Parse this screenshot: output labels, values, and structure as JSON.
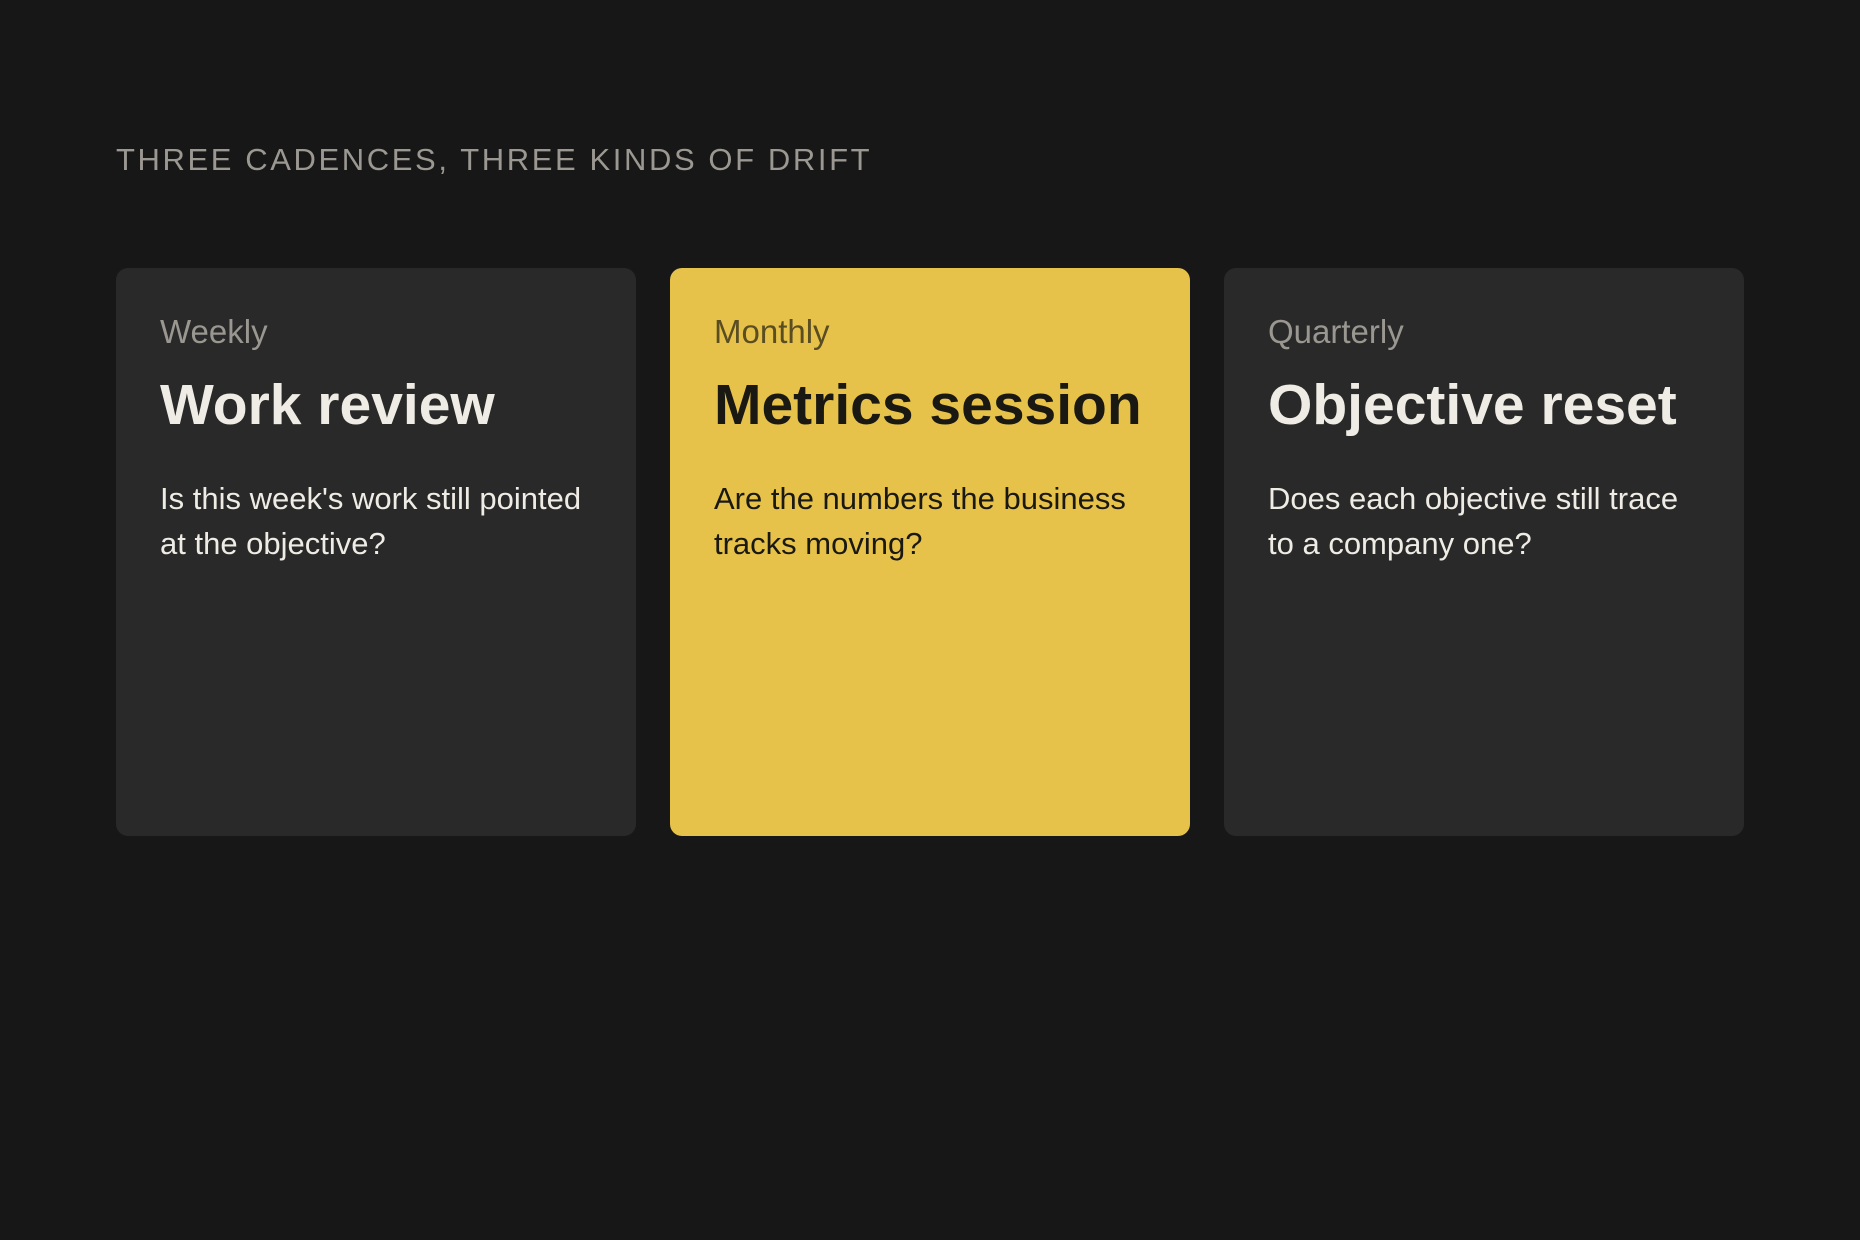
{
  "section": {
    "title": "THREE CADENCES, THREE KINDS OF DRIFT"
  },
  "cards": [
    {
      "cadence": "Weekly",
      "title": "Work review",
      "question": "Is this week's work still pointed at the objective?"
    },
    {
      "cadence": "Monthly",
      "title": "Metrics session",
      "question": "Are the numbers the business tracks moving?"
    },
    {
      "cadence": "Quarterly",
      "title": "Objective reset",
      "question": "Does each objective still trace to a company one?"
    }
  ],
  "colors": {
    "background": "#171717",
    "card": "#292929",
    "highlight": "#e7c24a",
    "text_light": "#efece5",
    "text_muted": "#9a9791"
  }
}
